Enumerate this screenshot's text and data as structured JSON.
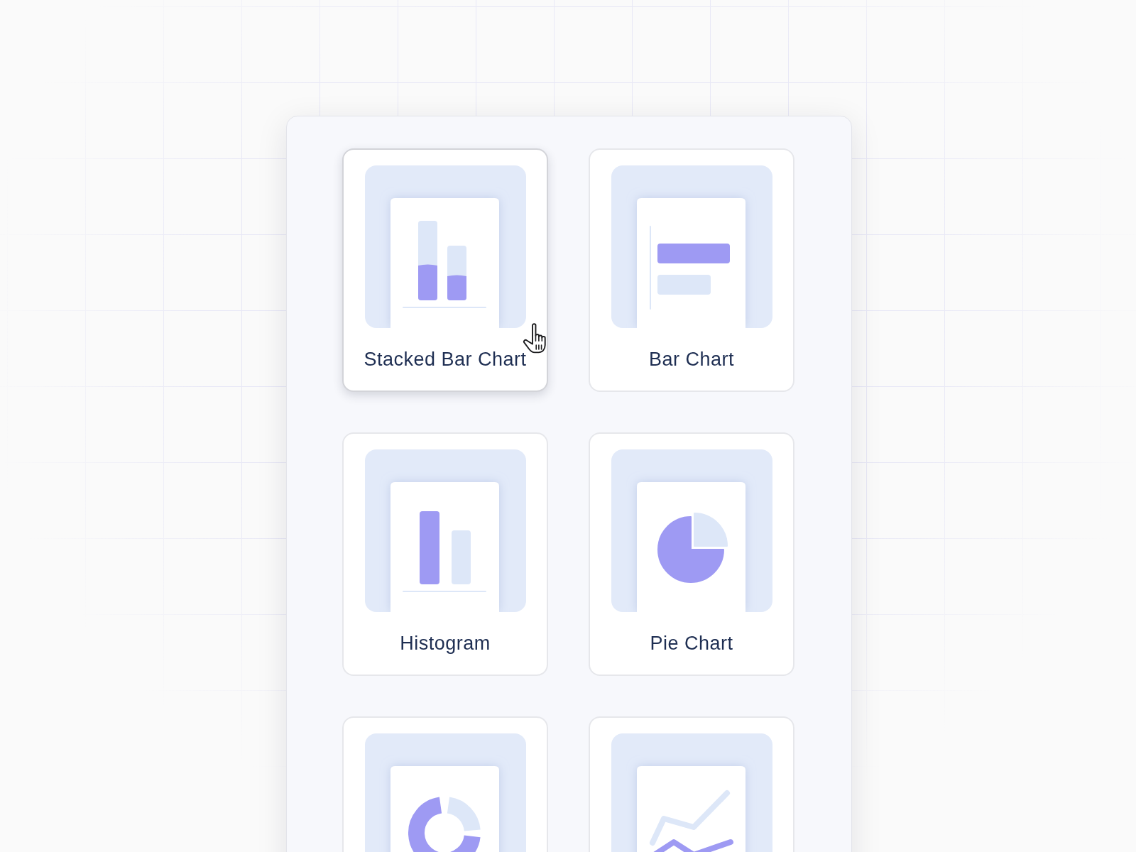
{
  "chart_types": [
    {
      "kind": "stacked-bar",
      "label": "Stacked Bar Chart",
      "hovered": true
    },
    {
      "kind": "bar",
      "label": "Bar Chart",
      "hovered": false
    },
    {
      "kind": "histogram",
      "label": "Histogram",
      "hovered": false
    },
    {
      "kind": "pie",
      "label": "Pie Chart",
      "hovered": false
    },
    {
      "kind": "donut",
      "hovered": false
    },
    {
      "kind": "line",
      "hovered": false
    }
  ]
}
